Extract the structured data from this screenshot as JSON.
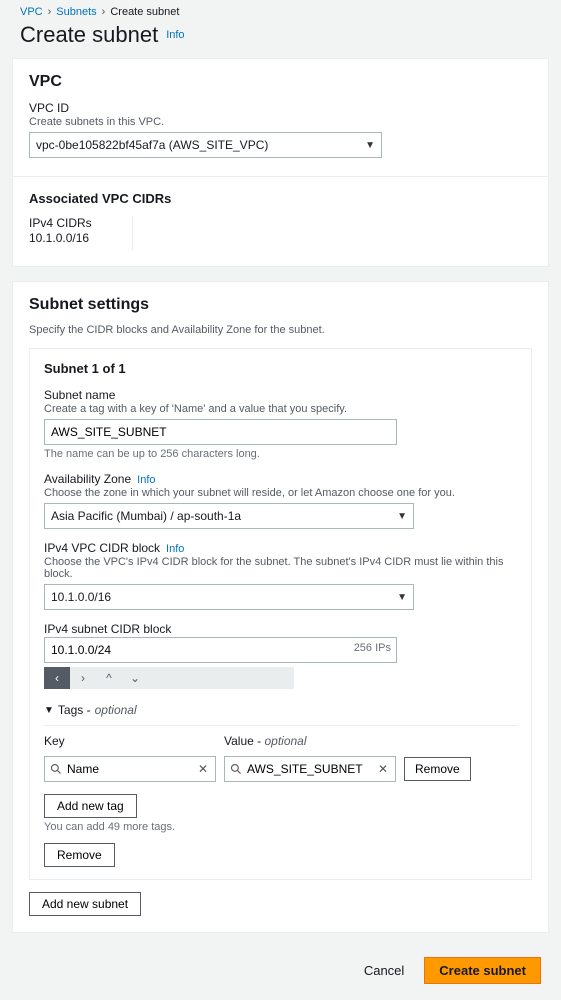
{
  "breadcrumb": {
    "vpc": "VPC",
    "subnets": "Subnets",
    "create": "Create subnet"
  },
  "pageTitle": "Create subnet",
  "infoLabel": "Info",
  "vpcPanel": {
    "title": "VPC",
    "vpcId": {
      "label": "VPC ID",
      "help": "Create subnets in this VPC.",
      "value": "vpc-0be105822bf45af7a (AWS_SITE_VPC)"
    },
    "assocTitle": "Associated VPC CIDRs",
    "ipv4": {
      "label": "IPv4 CIDRs",
      "value": "10.1.0.0/16"
    }
  },
  "subnetPanel": {
    "title": "Subnet settings",
    "help": "Specify the CIDR blocks and Availability Zone for the subnet.",
    "counter": "Subnet 1 of 1",
    "name": {
      "label": "Subnet name",
      "help": "Create a tag with a key of 'Name' and a value that you specify.",
      "value": "AWS_SITE_SUBNET",
      "below": "The name can be up to 256 characters long."
    },
    "az": {
      "label": "Availability Zone",
      "help": "Choose the zone in which your subnet will reside, or let Amazon choose one for you.",
      "value": "Asia Pacific (Mumbai) / ap-south-1a"
    },
    "vpcCidr": {
      "label": "IPv4 VPC CIDR block",
      "help": "Choose the VPC's IPv4 CIDR block for the subnet. The subnet's IPv4 CIDR must lie within this block.",
      "value": "10.1.0.0/16"
    },
    "subnetCidr": {
      "label": "IPv4 subnet CIDR block",
      "value": "10.1.0.0/24",
      "ips": "256 IPs"
    },
    "tags": {
      "header": "Tags - ",
      "optional": "optional",
      "keyLabel": "Key",
      "valueLabel": "Value - ",
      "valueOptional": "optional",
      "keyValue": "Name",
      "valueValue": "AWS_SITE_SUBNET",
      "removeBtn": "Remove",
      "addBtn": "Add new tag",
      "limit": "You can add 49 more tags."
    },
    "removeSubnetBtn": "Remove",
    "addSubnetBtn": "Add new subnet"
  },
  "footer": {
    "cancel": "Cancel",
    "create": "Create subnet"
  }
}
